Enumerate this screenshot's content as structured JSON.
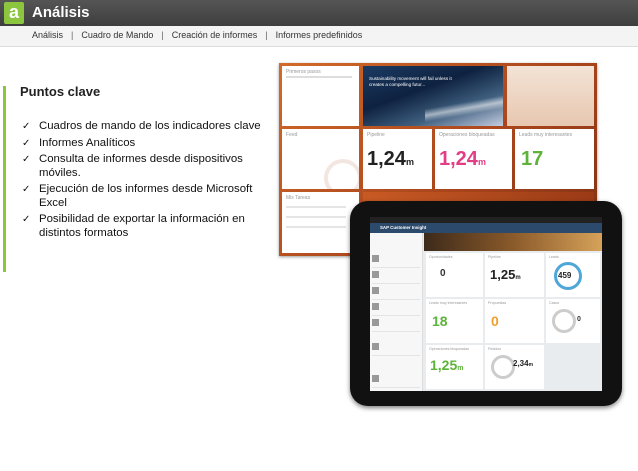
{
  "header": {
    "logo_letter": "a",
    "title": "Análisis"
  },
  "subnav": {
    "items": [
      "Análisis",
      "Cuadro de Mando",
      "Creación de informes",
      "Informes predefinidos"
    ],
    "separator": "|"
  },
  "key_points": {
    "title": "Puntos clave",
    "check": "✓",
    "items": [
      "Cuadros de mando de los indicadores clave",
      "Informes Analíticos",
      "Consulta de informes desde dispositivos móviles.",
      "Ejecución de los informes desde Microsoft Excel",
      "Posibilidad de exportar la información en distintos formatos"
    ]
  },
  "desktop_screenshot": {
    "first_steps": "Primeros pasos",
    "news_headline": "Sustainability movement will fail unless it creates a compelling futur...",
    "feed_label": "Feed",
    "pipeline_label": "Pipeline",
    "pipeline_value": "1,24",
    "pipeline_unit": "m",
    "blocked_label": "Operaciones bloqueadas",
    "blocked_value": "1,24",
    "blocked_unit": "m",
    "leads_label": "Leads muy interesantes",
    "leads_value": "17",
    "tasks_label": "Mis Tareas"
  },
  "tablet_screenshot": {
    "app_name": "SAP Customer Insight",
    "kpis": [
      {
        "value": "0",
        "label": "Oportunidades"
      },
      {
        "value": "1,25",
        "unit": "m",
        "label": "Pipeline"
      },
      {
        "value": "459",
        "label": "Leads"
      },
      {
        "value": "18",
        "label": "Leads muy interesantes"
      },
      {
        "value": "0",
        "label": "Propuestas"
      },
      {
        "value": "0",
        "label": "Casos"
      },
      {
        "value": "1,25",
        "unit": "m",
        "label": "Operaciones bloqueadas"
      },
      {
        "value": "2,34",
        "unit": "m",
        "label": "Pedidos"
      }
    ]
  }
}
